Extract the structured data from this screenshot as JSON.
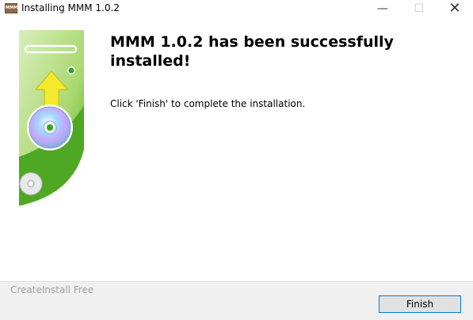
{
  "window": {
    "title": "Installing MMM 1.0.2",
    "icon": "app-icon",
    "controls": {
      "minimize": "minimize-icon",
      "maximize": "maximize-icon",
      "close": "close-icon"
    }
  },
  "main": {
    "headline": "MMM 1.0.2 has been successfully installed!",
    "instruction": "Click 'Finish' to complete the installation."
  },
  "footer": {
    "brand": "CreateInstall Free",
    "finish_label": "Finish"
  },
  "colors": {
    "accent_border": "#0078d7",
    "side_green": "#5db52b",
    "side_light": "#cfe8a8",
    "arrow_yellow": "#f2e62a"
  }
}
